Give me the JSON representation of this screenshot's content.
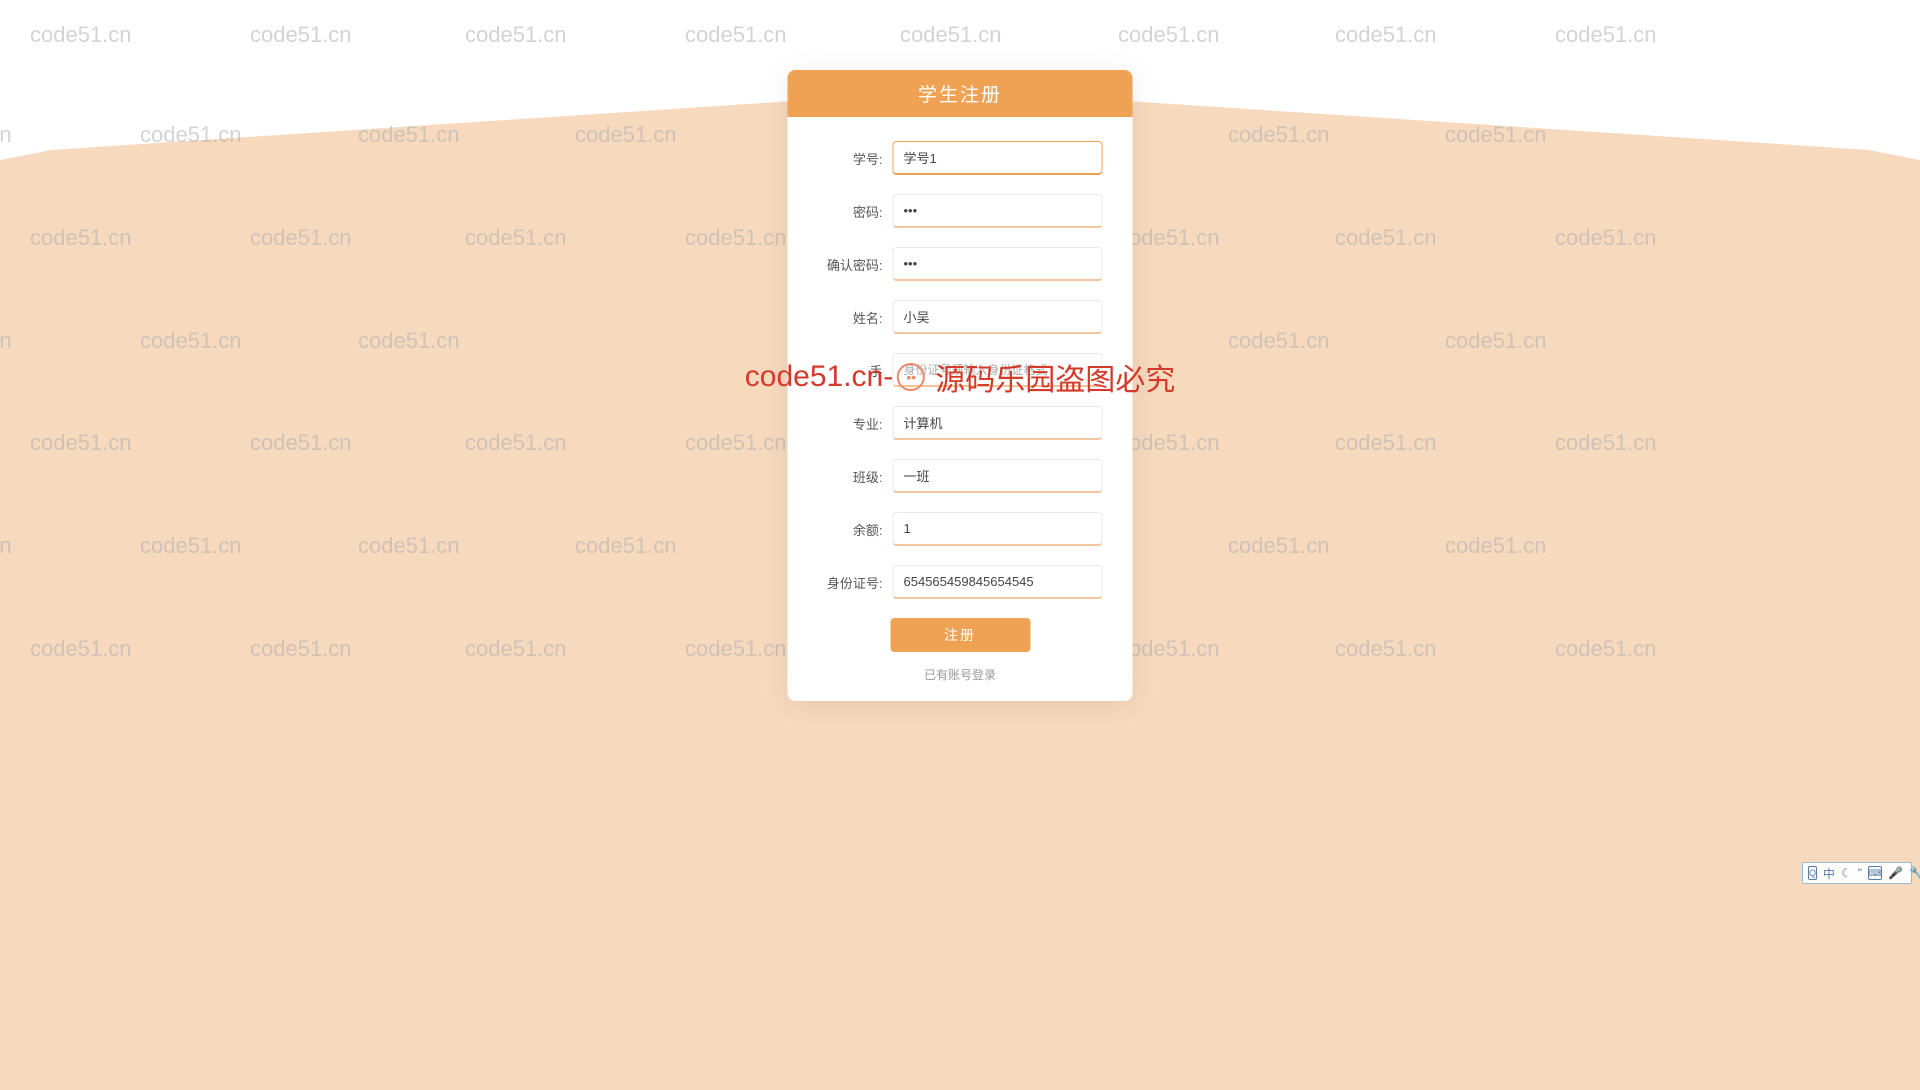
{
  "watermark_text": "code51.cn",
  "watermark_center": "code51.cn-源码乐园盗图必究",
  "card": {
    "title": "学生注册",
    "fields": {
      "student_id": {
        "label": "学号:",
        "value": "学号1"
      },
      "password": {
        "label": "密码:",
        "value": "•••"
      },
      "confirm_password": {
        "label": "确认密码:",
        "value": "•••"
      },
      "name": {
        "label": "姓名:",
        "value": "小吴"
      },
      "phone": {
        "label": "手",
        "placeholder": "身份证号须输入身份证格式"
      },
      "major": {
        "label": "专业:",
        "value": "计算机"
      },
      "class": {
        "label": "班级:",
        "value": "一班"
      },
      "balance": {
        "label": "余额:",
        "value": "1"
      },
      "id_number": {
        "label": "身份证号:",
        "value": "654565459845654545"
      }
    },
    "register_button": "注册",
    "login_link": "已有账号登录"
  },
  "ime": {
    "lang": "中"
  }
}
